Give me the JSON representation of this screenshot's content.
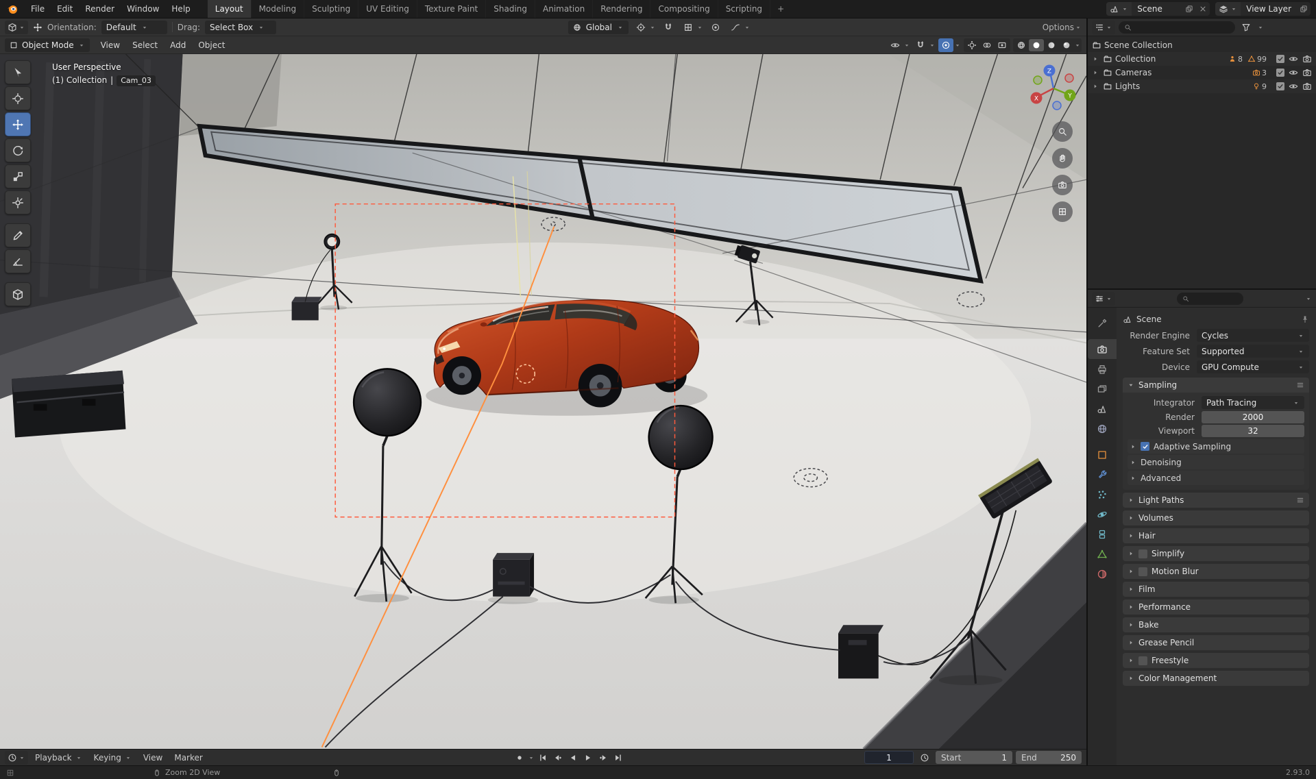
{
  "icons": {
    "blender-logo": "orange-blender-mark",
    "search-icon": "magnifier-glyph",
    "eye-icon": "open-eye",
    "camera-icon": "camera-body",
    "magnet-icon": "snap-magnet",
    "funnel-icon": "filter-funnel",
    "pin-icon": "panel-pin",
    "clock-icon": "playback-clock",
    "mouse-icon": "mouse-hint",
    "checkbox-check": "check-glyph"
  },
  "colors": {
    "accent": "#4772b3",
    "selection_outline": "#ff5a3c",
    "car_paint": "#b03a18"
  },
  "topbar": {
    "menus": [
      "File",
      "Edit",
      "Render",
      "Window",
      "Help"
    ],
    "workspaces": [
      "Layout",
      "Modeling",
      "Sculpting",
      "UV Editing",
      "Texture Paint",
      "Shading",
      "Animation",
      "Rendering",
      "Compositing",
      "Scripting"
    ],
    "active_workspace": "Layout",
    "add_workspace_label": "+",
    "scene_value": "Scene",
    "view_layer_value": "View Layer"
  },
  "tool_settings": {
    "orientation_label": "Orientation:",
    "orientation_value": "Default",
    "drag_label": "Drag:",
    "drag_value": "Select Box",
    "transform_orientation": "Global",
    "options_label": "Options"
  },
  "viewport": {
    "mode": "Object Mode",
    "menus": [
      "View",
      "Select",
      "Add",
      "Object"
    ],
    "overlay": {
      "perspective": "User Perspective",
      "collection": "(1) Collection",
      "separator": "|",
      "camera": "Cam_03"
    },
    "axis_labels": {
      "x": "X",
      "y": "Y",
      "z": "Z"
    }
  },
  "outliner": {
    "root": "Scene Collection",
    "items": [
      {
        "label": "Collection",
        "counts": [
          "8",
          "99"
        ]
      },
      {
        "label": "Cameras",
        "counts": [
          "3"
        ]
      },
      {
        "label": "Lights",
        "counts": [
          "9"
        ]
      }
    ]
  },
  "properties": {
    "breadcrumb": "Scene",
    "fields": [
      {
        "label": "Render Engine",
        "value": "Cycles"
      },
      {
        "label": "Feature Set",
        "value": "Supported"
      },
      {
        "label": "Device",
        "value": "GPU Compute"
      }
    ],
    "sampling": {
      "title": "Sampling",
      "integrator_label": "Integrator",
      "integrator_value": "Path Tracing",
      "render_label": "Render",
      "render_value": "2000",
      "viewport_label": "Viewport",
      "viewport_value": "32",
      "subpanels": [
        {
          "title": "Adaptive Sampling",
          "checked": true
        },
        {
          "title": "Denoising"
        },
        {
          "title": "Advanced"
        }
      ]
    },
    "panels": [
      {
        "title": "Light Paths"
      },
      {
        "title": "Volumes"
      },
      {
        "title": "Hair"
      },
      {
        "title": "Simplify",
        "checked": false
      },
      {
        "title": "Motion Blur",
        "checked": false
      },
      {
        "title": "Film"
      },
      {
        "title": "Performance"
      },
      {
        "title": "Bake"
      },
      {
        "title": "Grease Pencil"
      },
      {
        "title": "Freestyle",
        "checked": false
      },
      {
        "title": "Color Management"
      }
    ]
  },
  "timeline": {
    "menus": [
      "Playback",
      "Keying",
      "View",
      "Marker"
    ],
    "current_frame": "1",
    "start_label": "Start",
    "start_value": "1",
    "end_label": "End",
    "end_value": "250"
  },
  "statusbar": {
    "hint": "Zoom 2D View",
    "version": "2.93.0"
  }
}
